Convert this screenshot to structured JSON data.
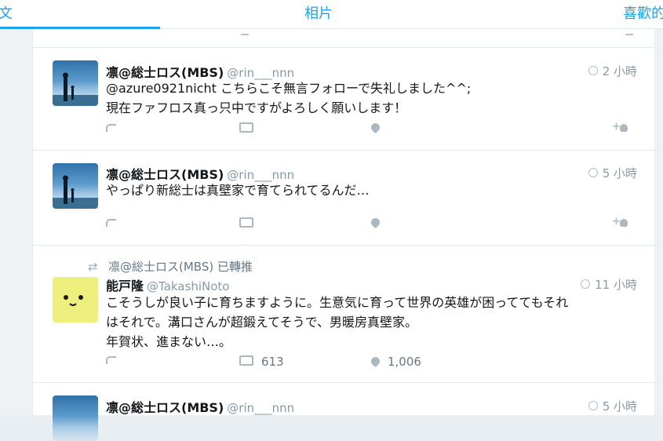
{
  "tabs": {
    "left": "文",
    "center": "相片",
    "right": "喜歡的"
  },
  "tweets": [
    {
      "name": "凛@総士ロス(MBS)",
      "handle": "@rin___nnn",
      "time": "2 小時",
      "lines": [
        "@azure0921nicht こちらこそ無言フォローで失礼しました^^;",
        "現在ファフロス真っ只中ですがよろしく願いします！"
      ]
    },
    {
      "name": "凛@総士ロス(MBS)",
      "handle": "@rin___nnn",
      "time": "5 小時",
      "lines": [
        "やっぱり新総士は真壁家で育てられてるんだ…"
      ]
    },
    {
      "retweeted_by": "凛@総士ロス(MBS) 已轉推",
      "name": "能戸隆",
      "handle": "@TakashiNoto",
      "time": "11 小時",
      "lines": [
        "こそうしが良い子に育ちますように。生意気に育って世界の英雄が困っててもそれ",
        "はそれで。溝口さんが超鍛えてそうで、男暖房真壁家。",
        "年賀状、進まない…。"
      ],
      "retweets": "613",
      "likes": "1,006"
    },
    {
      "name": "凛@総士ロス(MBS)",
      "handle": "@rin___nnn",
      "time": "5 小時"
    }
  ],
  "icons": {
    "reply": "reply-icon",
    "retweet": "retweet-icon",
    "like": "heart-icon",
    "follow": "follow-icon",
    "globe": "globe-icon"
  },
  "colors": {
    "accent": "#1da1f2",
    "muted": "#8899a6",
    "background": "#e9eef2"
  }
}
